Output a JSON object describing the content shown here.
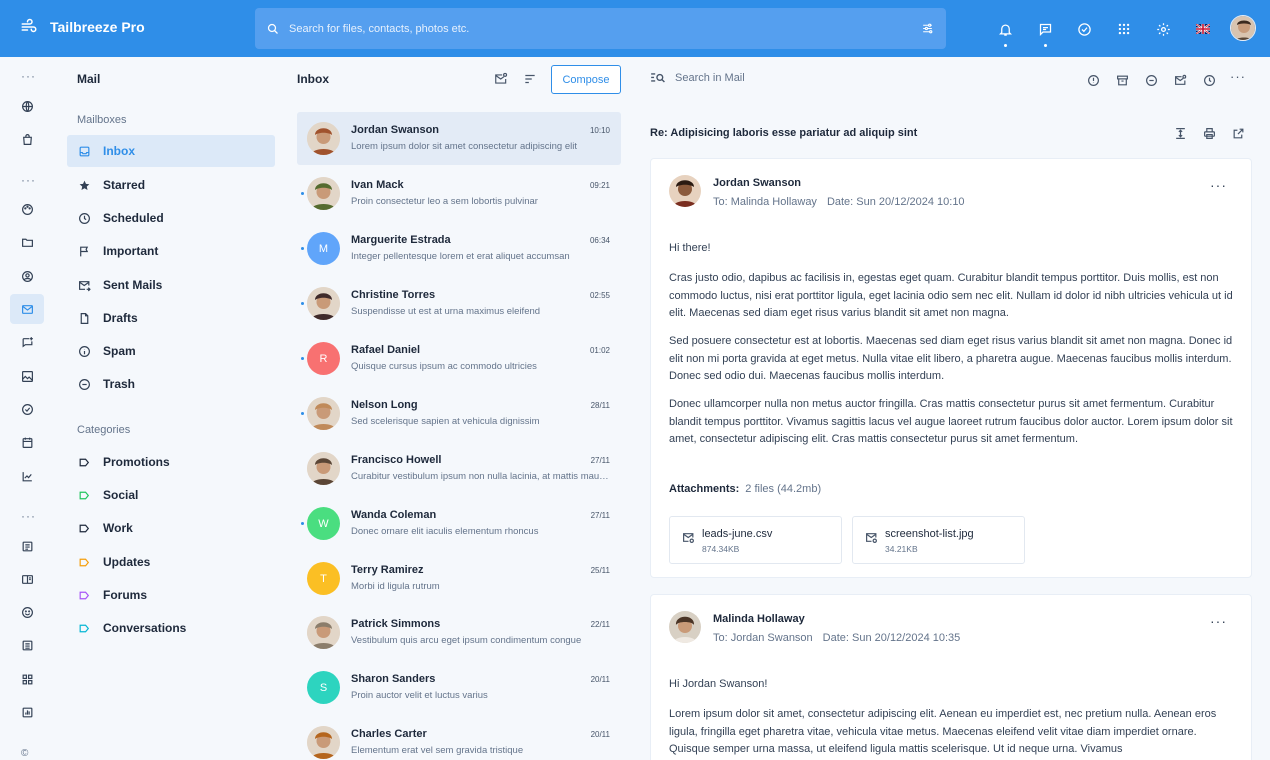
{
  "brand": {
    "name": "Tailbreeze Pro",
    "icon": "wind-icon"
  },
  "search": {
    "placeholder": "Search for files, contacts, photos etc."
  },
  "topbar_icons": [
    "bell-icon",
    "chat-icon",
    "check-circle-icon",
    "apps-grid-icon",
    "gear-icon",
    "uk-flag-icon",
    "user-avatar"
  ],
  "mailbox": {
    "title": "Mail",
    "mailboxes_heading": "Mailboxes",
    "items": [
      {
        "label": "Inbox",
        "icon": "inbox-icon"
      },
      {
        "label": "Starred",
        "icon": "star-icon"
      },
      {
        "label": "Scheduled",
        "icon": "clock-icon"
      },
      {
        "label": "Important",
        "icon": "flag-icon"
      },
      {
        "label": "Sent Mails",
        "icon": "mail-send-icon"
      },
      {
        "label": "Drafts",
        "icon": "file-icon"
      },
      {
        "label": "Spam",
        "icon": "info-icon"
      },
      {
        "label": "Trash",
        "icon": "minus-circle-icon"
      }
    ],
    "categories_heading": "Categories",
    "categories": [
      {
        "label": "Promotions",
        "color": "#1e293b"
      },
      {
        "label": "Social",
        "color": "#22c55e"
      },
      {
        "label": "Work",
        "color": "#1e293b"
      },
      {
        "label": "Updates",
        "color": "#f59e0b"
      },
      {
        "label": "Forums",
        "color": "#a855f7"
      },
      {
        "label": "Conversations",
        "color": "#06b6d4"
      }
    ]
  },
  "inbox": {
    "title": "Inbox",
    "compose_label": "Compose",
    "messages": [
      {
        "name": "Jordan Swanson",
        "preview": "Lorem ipsum dolor sit amet consectetur adipiscing elit",
        "time": "10:10",
        "unread": false,
        "avatar": "photo",
        "color": "#a0522d"
      },
      {
        "name": "Ivan Mack",
        "preview": "Proin consectetur leo a sem lobortis pulvinar",
        "time": "09:21",
        "unread": true,
        "avatar": "photo",
        "color": "#556b2f"
      },
      {
        "name": "Marguerite Estrada",
        "preview": "Integer pellentesque lorem et erat aliquet accumsan",
        "time": "06:34",
        "unread": true,
        "avatar": "M",
        "color": "#60a5fa"
      },
      {
        "name": "Christine Torres",
        "preview": "Suspendisse ut est at urna maximus eleifend",
        "time": "02:55",
        "unread": true,
        "avatar": "photo",
        "color": "#3f2a2a"
      },
      {
        "name": "Rafael Daniel",
        "preview": "Quisque cursus ipsum ac commodo ultricies",
        "time": "01:02",
        "unread": true,
        "avatar": "R",
        "color": "#f87171"
      },
      {
        "name": "Nelson Long",
        "preview": "Sed scelerisque sapien at vehicula dignissim",
        "time": "28/11",
        "unread": true,
        "avatar": "photo",
        "color": "#c08a5a"
      },
      {
        "name": "Francisco Howell",
        "preview": "Curabitur vestibulum ipsum non nulla lacinia, at mattis mauris dictum",
        "time": "27/11",
        "unread": false,
        "avatar": "photo",
        "color": "#5b4636"
      },
      {
        "name": "Wanda Coleman",
        "preview": "Donec ornare elit iaculis elementum rhoncus",
        "time": "27/11",
        "unread": true,
        "avatar": "W",
        "color": "#4ade80"
      },
      {
        "name": "Terry Ramirez",
        "preview": "Morbi id ligula rutrum",
        "time": "25/11",
        "unread": false,
        "avatar": "T",
        "color": "#fbbf24"
      },
      {
        "name": "Patrick Simmons",
        "preview": "Vestibulum quis arcu eget ipsum condimentum congue",
        "time": "22/11",
        "unread": false,
        "avatar": "photo",
        "color": "#8b7d6b"
      },
      {
        "name": "Sharon Sanders",
        "preview": "Proin auctor velit et luctus varius",
        "time": "20/11",
        "unread": false,
        "avatar": "S",
        "color": "#2dd4bf"
      },
      {
        "name": "Charles Carter",
        "preview": "Elementum erat vel sem gravida tristique",
        "time": "20/11",
        "unread": false,
        "avatar": "photo",
        "color": "#b5651d"
      }
    ]
  },
  "reader": {
    "search_placeholder": "Search in Mail",
    "subject": "Re: Adipisicing laboris esse pariatur ad aliquip sint",
    "toolbar_icons": [
      "alert-circle-icon",
      "archive-icon",
      "minus-circle-icon",
      "mail-icon",
      "clock-icon",
      "more-icon"
    ],
    "subject_icons": [
      "expand-vertical-icon",
      "printer-icon",
      "external-link-icon"
    ],
    "message1": {
      "from": "Jordan Swanson",
      "to": "To: Malinda Hollaway",
      "date": "Date: Sun 20/12/2024 10:10",
      "greeting": "Hi there!",
      "para1": "Cras justo odio, dapibus ac facilisis in, egestas eget quam. Curabitur blandit tempus porttitor. Duis mollis, est non commodo luctus, nisi erat porttitor ligula, eget lacinia odio sem nec elit. Nullam id dolor id nibh ultricies vehicula ut id elit. Maecenas sed diam eget risus varius blandit sit amet non magna.",
      "para2": "Sed posuere consectetur est at lobortis. Maecenas sed diam eget risus varius blandit sit amet non magna. Donec id elit non mi porta gravida at eget metus. Nulla vitae elit libero, a pharetra augue. Maecenas faucibus mollis interdum. Donec sed odio dui. Maecenas faucibus mollis interdum.",
      "para3": "Donec ullamcorper nulla non metus auctor fringilla. Cras mattis consectetur purus sit amet fermentum. Curabitur blandit tempus porttitor. Vivamus sagittis lacus vel augue laoreet rutrum faucibus dolor auctor. Lorem ipsum dolor sit amet, consectetur adipiscing elit. Cras mattis consectetur purus sit amet fermentum.",
      "attachments_label": "Attachments:",
      "attachments_summary": "2 files (44.2mb)",
      "files": [
        {
          "name": "leads-june.csv",
          "size": "874.34KB"
        },
        {
          "name": "screenshot-list.jpg",
          "size": "34.21KB"
        }
      ]
    },
    "message2": {
      "from": "Malinda Hollaway",
      "to": "To: Jordan Swanson",
      "date": "Date: Sun 20/12/2024 10:35",
      "greeting": "Hi Jordan Swanson!",
      "para1": "Lorem ipsum dolor sit amet, consectetur adipiscing elit. Aenean eu imperdiet est, nec pretium nulla. Aenean eros ligula, fringilla eget pharetra vitae, vehicula vitae metus. Maecenas eleifend velit vitae diam imperdiet ornare. Quisque semper urna massa, ut eleifend ligula mattis scelerisque. Ut id neque urna. Vivamus"
    }
  },
  "footer": {
    "copyright": "©"
  }
}
